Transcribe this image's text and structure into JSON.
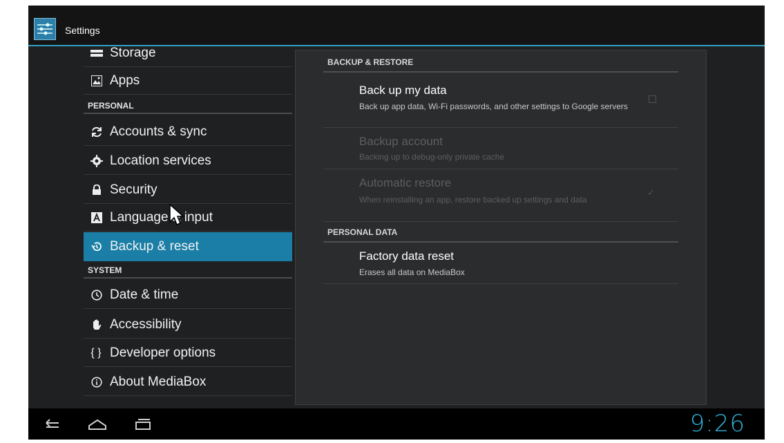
{
  "app": {
    "title": "Settings",
    "icon": "settings-sliders-icon"
  },
  "sidebar": {
    "items": [
      {
        "label": "Storage",
        "icon": "storage-icon"
      },
      {
        "label": "Apps",
        "icon": "apps-icon"
      },
      {
        "label": "Accounts & sync",
        "icon": "sync-icon"
      },
      {
        "label": "Location services",
        "icon": "location-icon"
      },
      {
        "label": "Security",
        "icon": "lock-icon"
      },
      {
        "label": "Language & input",
        "icon": "keyboard-a-icon"
      },
      {
        "label": "Backup & reset",
        "icon": "restore-icon",
        "selected": true
      },
      {
        "label": "Date & time",
        "icon": "clock-icon"
      },
      {
        "label": "Accessibility",
        "icon": "hand-icon"
      },
      {
        "label": "Developer options",
        "icon": "braces-icon"
      },
      {
        "label": "About MediaBox",
        "icon": "info-icon"
      }
    ],
    "headers": {
      "personal": "PERSONAL",
      "system": "SYSTEM"
    }
  },
  "main": {
    "sections": [
      {
        "header": "BACKUP & RESTORE",
        "prefs": [
          {
            "title": "Back up my data",
            "summary": "Back up app data, Wi-Fi passwords, and other settings to Google servers",
            "enabled": true,
            "checked": false
          },
          {
            "title": "Backup account",
            "summary": "Backing up to debug-only private cache",
            "enabled": false
          },
          {
            "title": "Automatic restore",
            "summary": "When reinstalling an app, restore backed up settings and data",
            "enabled": false,
            "checked": true
          }
        ]
      },
      {
        "header": "PERSONAL DATA",
        "prefs": [
          {
            "title": "Factory data reset",
            "summary": "Erases all data on MediaBox",
            "enabled": true
          }
        ]
      }
    ]
  },
  "navbar": {
    "back_icon": "back-icon",
    "home_icon": "home-icon",
    "recents_icon": "recents-icon",
    "clock": "9:26"
  },
  "colors": {
    "accent": "#2fa3c4",
    "selected": "#1a7ea6",
    "clock": "#2fb2d8"
  }
}
